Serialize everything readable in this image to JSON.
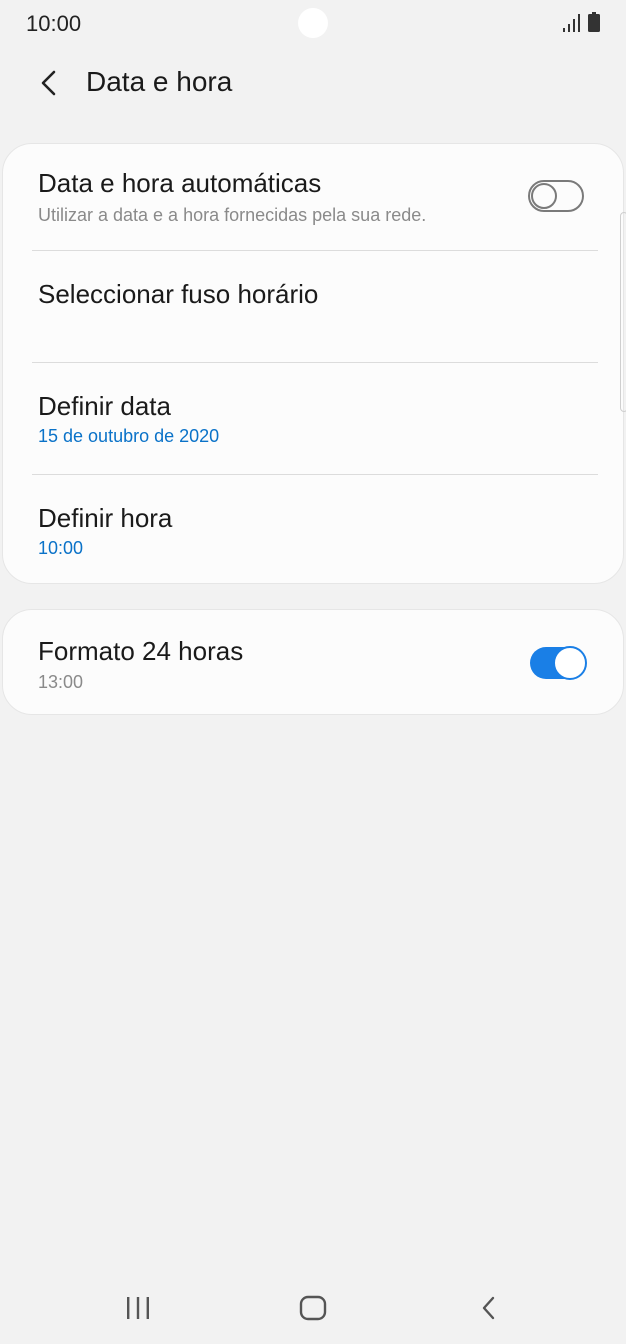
{
  "status_bar": {
    "time": "10:00"
  },
  "header": {
    "title": "Data e hora"
  },
  "settings": {
    "auto_datetime": {
      "title": "Data e hora automáticas",
      "subtitle": "Utilizar a data e a hora fornecidas pela sua rede.",
      "enabled": false
    },
    "timezone": {
      "title": "Seleccionar fuso horário"
    },
    "set_date": {
      "title": "Definir data",
      "value": "15 de outubro de 2020"
    },
    "set_time": {
      "title": "Definir hora",
      "value": "10:00"
    },
    "format_24h": {
      "title": "Formato 24 horas",
      "subtitle": "13:00",
      "enabled": true
    }
  },
  "colors": {
    "accent": "#1a7fe6",
    "link": "#0a72c8",
    "background": "#f2f2f2",
    "card": "#fcfcfc"
  },
  "icons": {
    "back": "chevron-left-icon",
    "recents": "recents-icon",
    "home": "home-icon",
    "nav_back": "nav-back-icon"
  }
}
